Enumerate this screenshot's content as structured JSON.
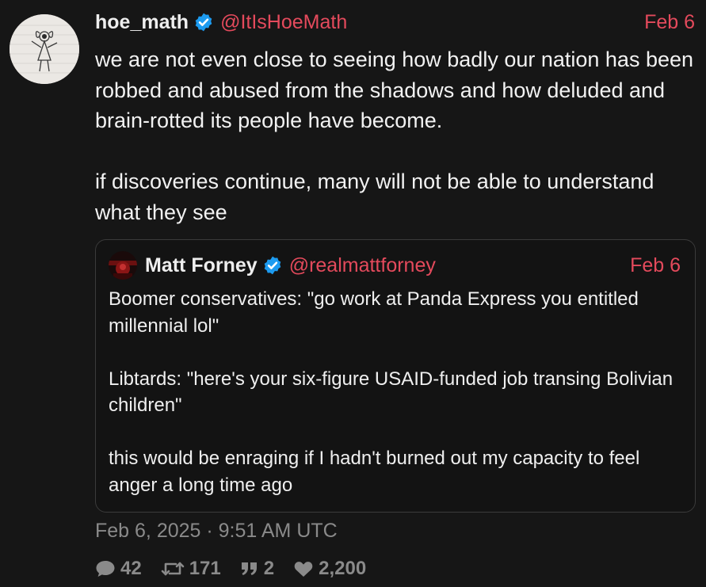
{
  "tweet": {
    "display_name": "hoe_math",
    "handle": "@ItIsHoeMath",
    "date": "Feb 6",
    "text": "we are not even close to seeing how badly our nation has been robbed and abused from the shadows and how deluded and brain-rotted its people have become.\n\nif discoveries continue, many will not be able to understand what they see",
    "avatar_icon": "stick-figure-drawing",
    "verified_icon": "verified-badge-icon"
  },
  "quote": {
    "display_name": "Matt Forney",
    "handle": "@realmattforney",
    "date": "Feb 6",
    "text": "Boomer conservatives: \"go work at Panda Express you entitled millennial lol\"\n\nLibtards: \"here's your six-figure USAID-funded job transing Bolivian children\"\n\nthis would be enraging if I hadn't burned out my capacity to feel anger a long time ago"
  },
  "timestamp": "Feb 6, 2025 · 9:51 AM UTC",
  "stats": {
    "replies": "42",
    "retweets": "171",
    "quotes": "2",
    "likes": "2,200"
  },
  "colors": {
    "background": "#161616",
    "accent": "#e44a5c",
    "verified": "#1d9bf0",
    "muted": "#8a8a8a"
  }
}
